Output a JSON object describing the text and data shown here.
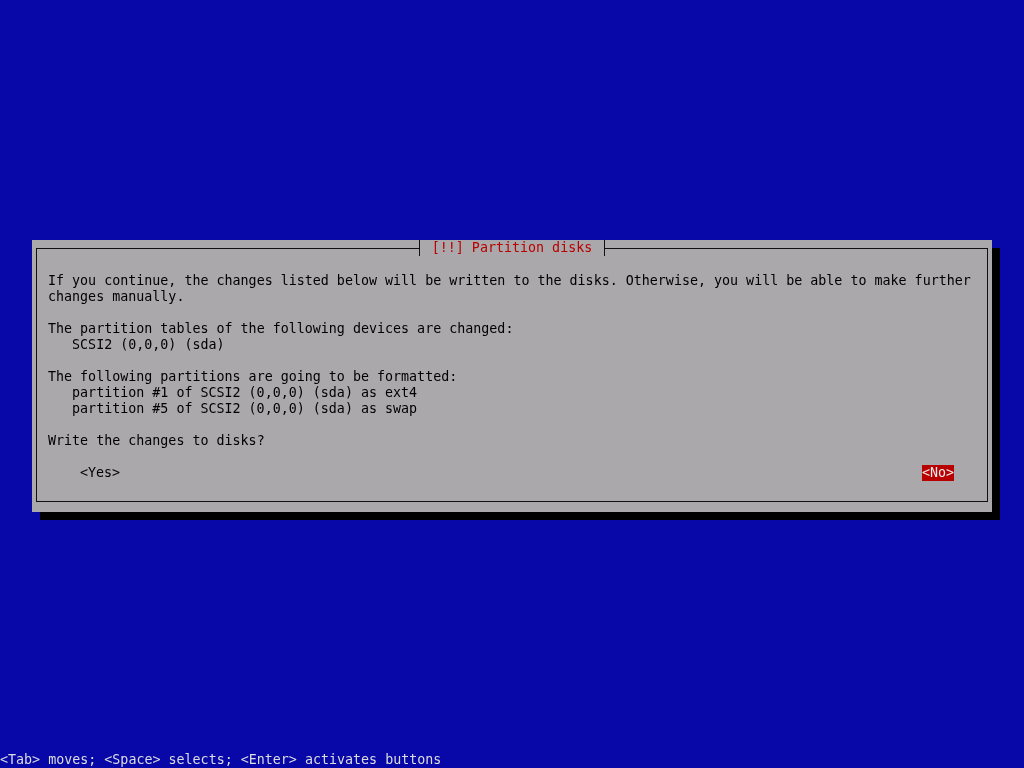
{
  "dialog": {
    "title": "[!!] Partition disks",
    "intro": "If you continue, the changes listed below will be written to the disks. Otherwise, you will be able to make further changes manually.",
    "sections": [
      {
        "heading": "The partition tables of the following devices are changed:",
        "items": [
          "SCSI2 (0,0,0) (sda)"
        ]
      },
      {
        "heading": "The following partitions are going to be formatted:",
        "items": [
          "partition #1 of SCSI2 (0,0,0) (sda) as ext4",
          "partition #5 of SCSI2 (0,0,0) (sda) as swap"
        ]
      }
    ],
    "question": "Write the changes to disks?",
    "buttons": [
      {
        "label": "<Yes>",
        "selected": false
      },
      {
        "label": "<No>",
        "selected": true
      }
    ]
  },
  "status_bar": "<Tab> moves; <Space> selects; <Enter> activates buttons"
}
